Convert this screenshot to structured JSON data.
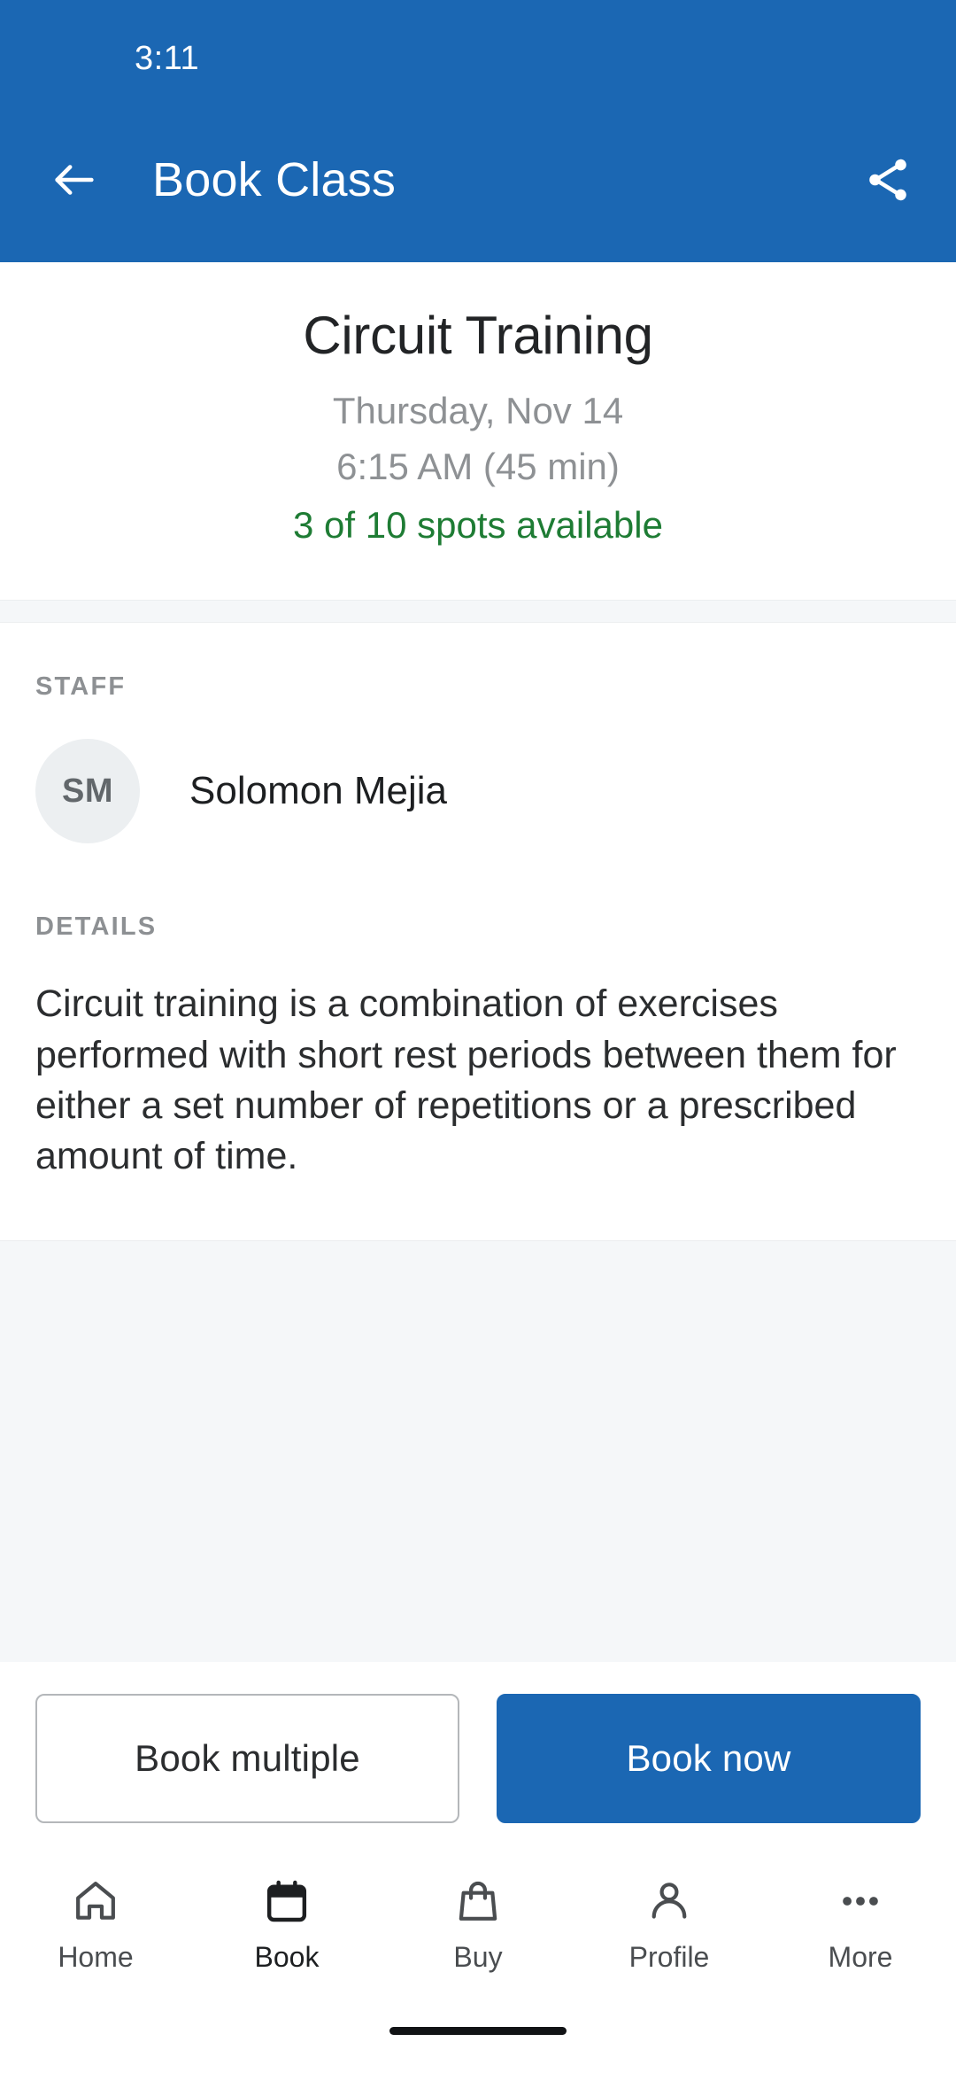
{
  "statusbar": {
    "time": "3:11"
  },
  "appbar": {
    "title": "Book Class",
    "back_icon": "arrow-left-icon",
    "share_icon": "share-icon",
    "background": "#1b67b3"
  },
  "hero": {
    "class_name": "Circuit Training",
    "date": "Thursday, Nov 14",
    "time": "6:15 AM (45 min)",
    "spots": "3 of 10 spots available",
    "spots_color": "#1e7c34",
    "muted_color": "#8e9194"
  },
  "staff": {
    "label": "STAFF",
    "initials": "SM",
    "name": "Solomon Mejia"
  },
  "details": {
    "label": "DETAILS",
    "body": "Circuit training is a combination of exercises performed with short rest periods between them for either a set number of repetitions or a prescribed amount of time."
  },
  "actions": {
    "secondary_label": "Book multiple",
    "primary_label": "Book now",
    "primary_color": "#1b67b3"
  },
  "bottom_nav": {
    "items": [
      {
        "label": "Home",
        "icon": "home-icon",
        "active": false
      },
      {
        "label": "Book",
        "icon": "calendar-icon",
        "active": true
      },
      {
        "label": "Buy",
        "icon": "bag-icon",
        "active": false
      },
      {
        "label": "Profile",
        "icon": "person-icon",
        "active": false
      },
      {
        "label": "More",
        "icon": "more-dots-icon",
        "active": false
      }
    ]
  }
}
